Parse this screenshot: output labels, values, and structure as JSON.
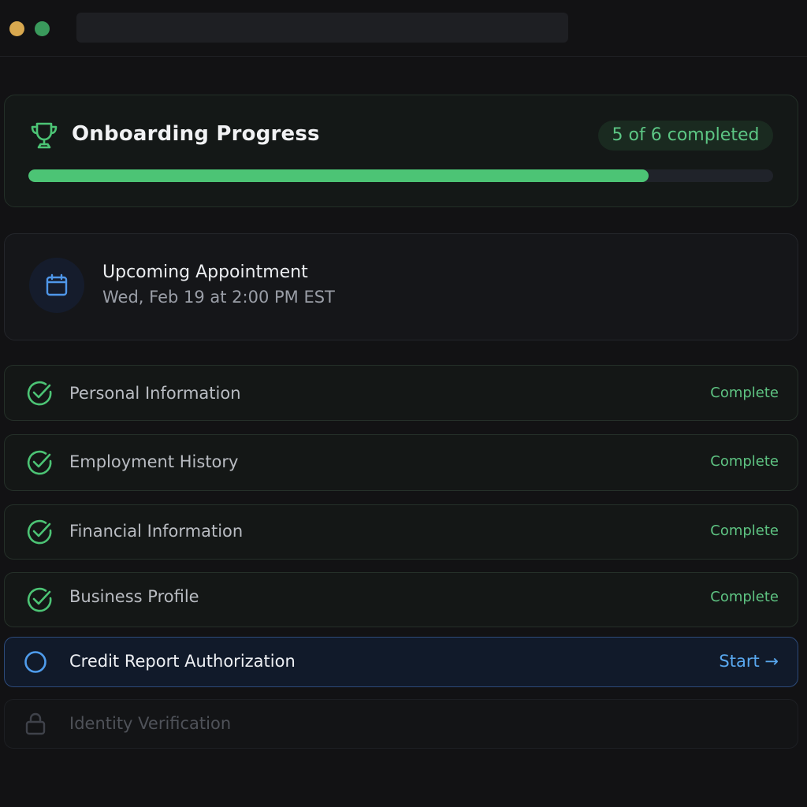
{
  "progress": {
    "title": "Onboarding Progress",
    "badge": "5 of 6 completed",
    "completed": 5,
    "total": 6,
    "fraction": 0.833
  },
  "appointment": {
    "title": "Upcoming Appointment",
    "datetime": "Wed, Feb 19 at 2:00 PM EST"
  },
  "tasks": [
    {
      "label": "Personal Information",
      "status": "Complete",
      "state": "complete"
    },
    {
      "label": "Employment History",
      "status": "Complete",
      "state": "complete"
    },
    {
      "label": "Financial Information",
      "status": "Complete",
      "state": "complete"
    },
    {
      "label": "Business Profile",
      "status": "Complete",
      "state": "complete"
    },
    {
      "label": "Credit Report Authorization",
      "status": "Start →",
      "state": "active"
    },
    {
      "label": "Identity Verification",
      "status": "",
      "state": "locked"
    }
  ],
  "colors": {
    "accent_green": "#4cc475",
    "accent_blue": "#59a8ef",
    "background": "#121214"
  },
  "icons": {
    "header": "trophy-icon",
    "appointment": "calendar-icon",
    "complete": "check-circle-icon",
    "active": "empty-circle-icon",
    "locked": "lock-icon"
  }
}
